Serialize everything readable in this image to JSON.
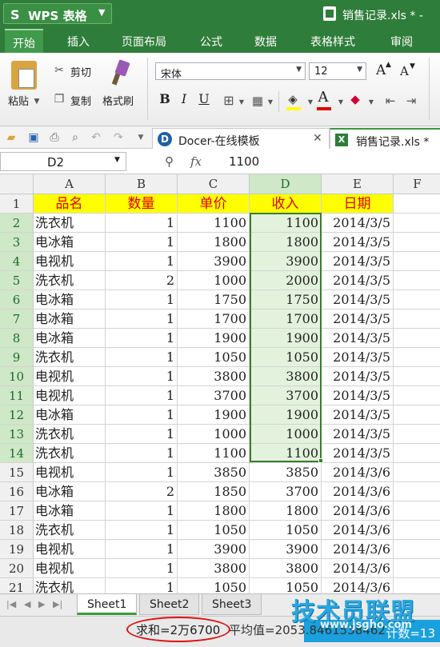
{
  "app": {
    "logo": "S",
    "name": "WPS 表格",
    "window_title": "销售记录.xls * -"
  },
  "menu": [
    "开始",
    "插入",
    "页面布局",
    "公式",
    "数据",
    "表格样式",
    "审阅"
  ],
  "ribbon": {
    "paste": "粘贴",
    "cut": "剪切",
    "copy": "复制",
    "format_painter": "格式刷",
    "font_name": "宋体",
    "font_size": "12",
    "bold": "B",
    "italic": "I",
    "underline": "U",
    "grow_font": "A",
    "shrink_font": "A"
  },
  "tabs": {
    "docer": "Docer-在线模板",
    "file": "销售记录.xls *"
  },
  "formula_bar": {
    "cell_ref": "D2",
    "fx": "fx",
    "value": "1100"
  },
  "grid": {
    "columns": [
      "A",
      "B",
      "C",
      "D",
      "E",
      "F"
    ],
    "headers": [
      "品名",
      "数量",
      "单价",
      "收入",
      "日期"
    ],
    "rows": [
      [
        "洗衣机",
        "1",
        "1100",
        "1100",
        "2014/3/5"
      ],
      [
        "电冰箱",
        "1",
        "1800",
        "1800",
        "2014/3/5"
      ],
      [
        "电视机",
        "1",
        "3900",
        "3900",
        "2014/3/5"
      ],
      [
        "洗衣机",
        "2",
        "1000",
        "2000",
        "2014/3/5"
      ],
      [
        "电冰箱",
        "1",
        "1750",
        "1750",
        "2014/3/5"
      ],
      [
        "电冰箱",
        "1",
        "1700",
        "1700",
        "2014/3/5"
      ],
      [
        "电冰箱",
        "1",
        "1900",
        "1900",
        "2014/3/5"
      ],
      [
        "洗衣机",
        "1",
        "1050",
        "1050",
        "2014/3/5"
      ],
      [
        "电视机",
        "1",
        "3800",
        "3800",
        "2014/3/5"
      ],
      [
        "电视机",
        "1",
        "3700",
        "3700",
        "2014/3/5"
      ],
      [
        "电冰箱",
        "1",
        "1900",
        "1900",
        "2014/3/5"
      ],
      [
        "洗衣机",
        "1",
        "1000",
        "1000",
        "2014/3/5"
      ],
      [
        "洗衣机",
        "1",
        "1100",
        "1100",
        "2014/3/5"
      ],
      [
        "电视机",
        "1",
        "3850",
        "3850",
        "2014/3/6"
      ],
      [
        "电冰箱",
        "2",
        "1850",
        "3700",
        "2014/3/6"
      ],
      [
        "电冰箱",
        "1",
        "1800",
        "1800",
        "2014/3/6"
      ],
      [
        "洗衣机",
        "1",
        "1050",
        "1050",
        "2014/3/6"
      ],
      [
        "电视机",
        "1",
        "3900",
        "3900",
        "2014/3/6"
      ],
      [
        "电视机",
        "1",
        "3800",
        "3800",
        "2014/3/6"
      ],
      [
        "洗衣机",
        "1",
        "1050",
        "1050",
        "2014/3/6"
      ]
    ]
  },
  "sheets": [
    "Sheet1",
    "Sheet2",
    "Sheet3"
  ],
  "watermark": {
    "title": "技术员联盟",
    "url": "www.jsgho.com"
  },
  "status": {
    "sum": "求和=2万6700",
    "average": "平均值=2053.8461538462",
    "count": "计数=13"
  },
  "colors": {
    "accent": "#2f7d3a",
    "header_fill": "#ffff00",
    "header_text": "#e00000",
    "selection": "#e3f2dd",
    "annotation": "#e01010"
  }
}
